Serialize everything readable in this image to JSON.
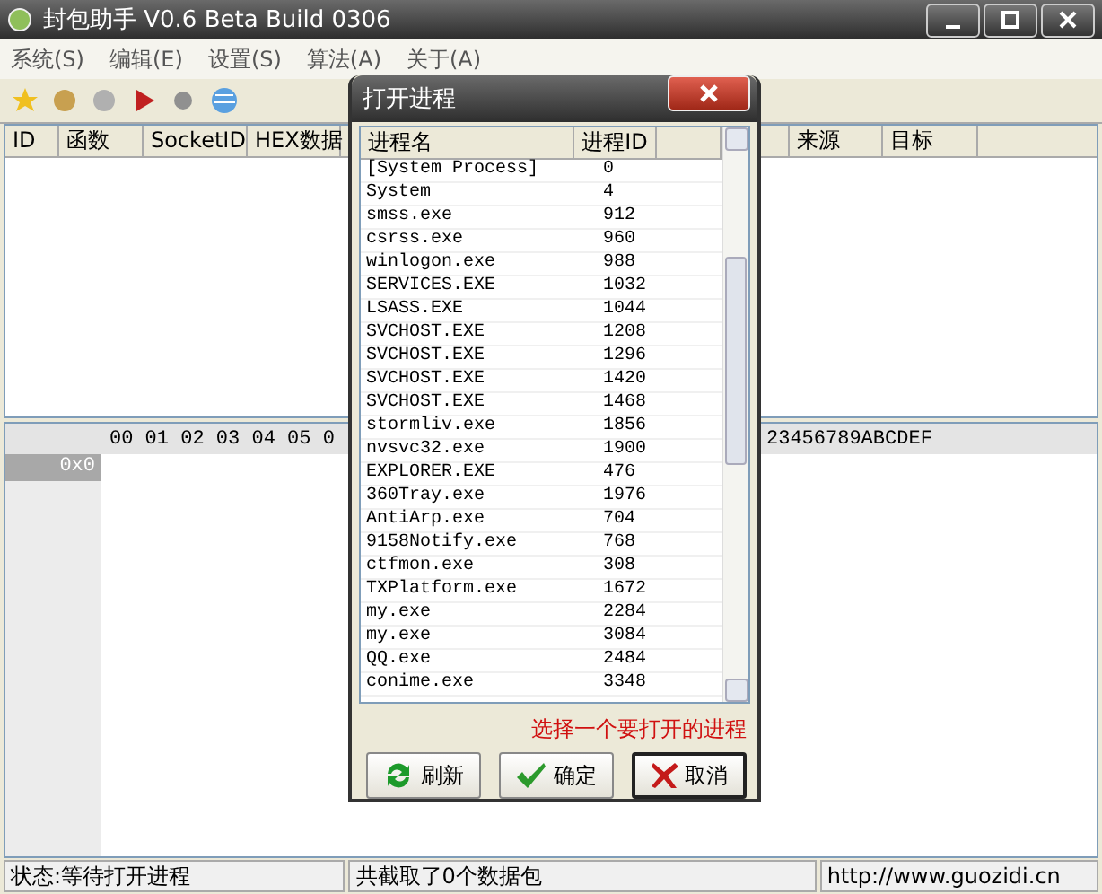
{
  "window": {
    "title": "封包助手 V0.6 Beta Build 0306"
  },
  "menu": [
    "系统(S)",
    "编辑(E)",
    "设置(S)",
    "算法(A)",
    "关于(A)"
  ],
  "packet_table": {
    "columns": [
      "ID",
      "函数",
      "SocketID",
      "HEX数据",
      "",
      "来源",
      "目标"
    ]
  },
  "hex_view": {
    "header_left": "00 01 02 03 04 05 0",
    "header_right": "23456789ABCDEF",
    "row_label": "0x0"
  },
  "dialog": {
    "title": "打开进程",
    "columns": [
      "进程名",
      "进程ID"
    ],
    "rows": [
      {
        "name": "[System Process]",
        "pid": "0"
      },
      {
        "name": "System",
        "pid": "4"
      },
      {
        "name": "smss.exe",
        "pid": "912"
      },
      {
        "name": "csrss.exe",
        "pid": "960"
      },
      {
        "name": "winlogon.exe",
        "pid": "988"
      },
      {
        "name": "SERVICES.EXE",
        "pid": "1032"
      },
      {
        "name": "LSASS.EXE",
        "pid": "1044"
      },
      {
        "name": "SVCHOST.EXE",
        "pid": "1208"
      },
      {
        "name": "SVCHOST.EXE",
        "pid": "1296"
      },
      {
        "name": "SVCHOST.EXE",
        "pid": "1420"
      },
      {
        "name": "SVCHOST.EXE",
        "pid": "1468"
      },
      {
        "name": "stormliv.exe",
        "pid": "1856"
      },
      {
        "name": "nvsvc32.exe",
        "pid": "1900"
      },
      {
        "name": "EXPLORER.EXE",
        "pid": "476"
      },
      {
        "name": "360Tray.exe",
        "pid": "1976"
      },
      {
        "name": "AntiArp.exe",
        "pid": "704"
      },
      {
        "name": "9158Notify.exe",
        "pid": "768"
      },
      {
        "name": "ctfmon.exe",
        "pid": "308"
      },
      {
        "name": "TXPlatform.exe",
        "pid": "1672"
      },
      {
        "name": "my.exe",
        "pid": "2284"
      },
      {
        "name": "my.exe",
        "pid": "3084"
      },
      {
        "name": "QQ.exe",
        "pid": "2484"
      },
      {
        "name": "conime.exe",
        "pid": "3348"
      }
    ],
    "hint": "选择一个要打开的进程",
    "buttons": [
      {
        "kind": "refresh",
        "label": "刷新",
        "default": false
      },
      {
        "kind": "ok",
        "label": "确定",
        "default": false
      },
      {
        "kind": "cancel",
        "label": "取消",
        "default": true
      }
    ]
  },
  "status_bar": [
    "状态:等待打开进程",
    "共截取了0个数据包",
    "http://www.guozidi.cn"
  ]
}
